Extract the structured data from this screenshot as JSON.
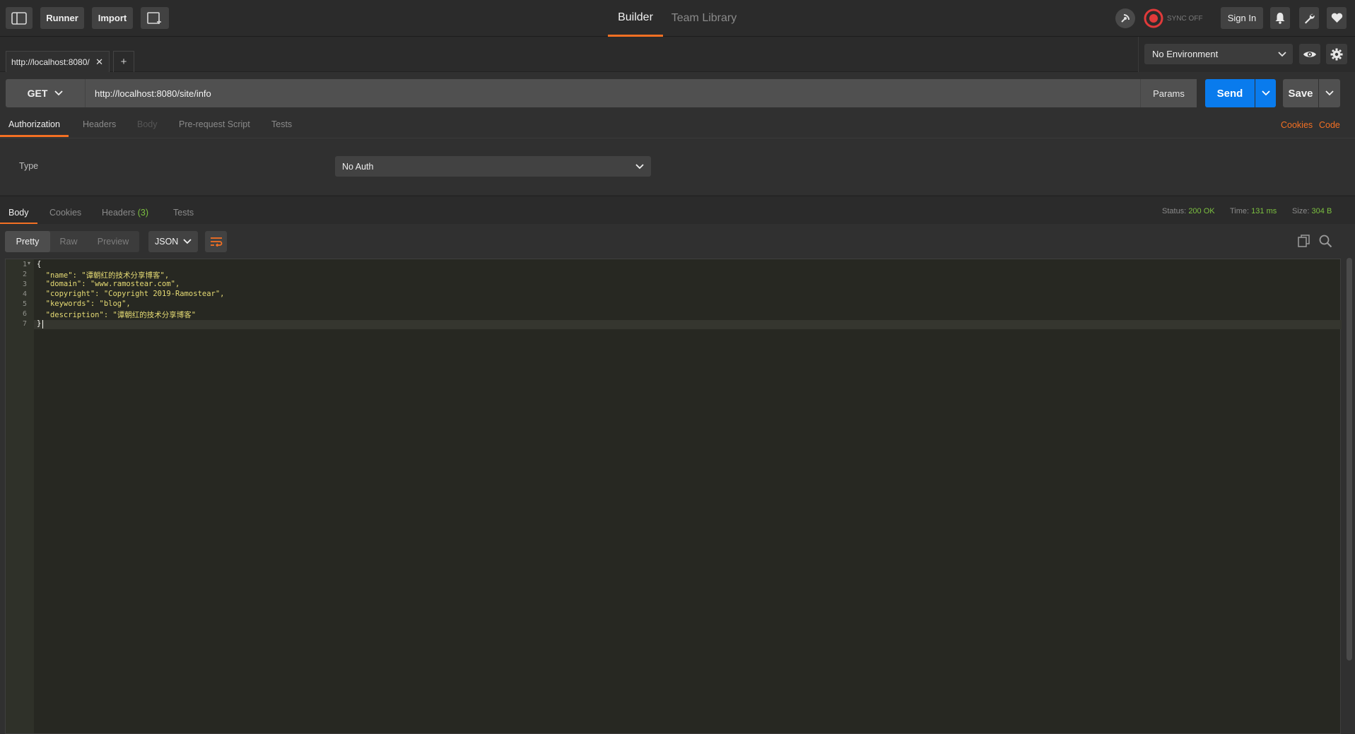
{
  "topbar": {
    "runner_label": "Runner",
    "import_label": "Import",
    "center_tabs": [
      "Builder",
      "Team Library"
    ],
    "sync_label": "SYNC OFF",
    "signin_label": "Sign In"
  },
  "tabs": {
    "active_tab_label": "http://localhost:8080/",
    "close_label": "✕",
    "add_label": "+"
  },
  "environment": {
    "selected": "No Environment"
  },
  "request": {
    "method": "GET",
    "url": "http://localhost:8080/site/info",
    "params_label": "Params",
    "send_label": "Send",
    "save_label": "Save"
  },
  "request_tabs": [
    "Authorization",
    "Headers",
    "Body",
    "Pre-request Script",
    "Tests"
  ],
  "request_links": [
    "Cookies",
    "Code"
  ],
  "auth": {
    "type_label": "Type",
    "selected": "No Auth"
  },
  "response_tabs": {
    "body": "Body",
    "cookies": "Cookies",
    "headers": "Headers",
    "headers_count": "(3)",
    "tests": "Tests"
  },
  "response_stats": {
    "status_label": "Status:",
    "status_value": "200 OK",
    "time_label": "Time:",
    "time_value": "131 ms",
    "size_label": "Size:",
    "size_value": "304 B"
  },
  "format": {
    "modes": [
      "Pretty",
      "Raw",
      "Preview"
    ],
    "language": "JSON"
  },
  "editor": {
    "line_numbers": [
      "1",
      "2",
      "3",
      "4",
      "5",
      "6",
      "7"
    ],
    "lines": [
      "{",
      "  \"name\": \"谭朝红的技术分享博客\",",
      "  \"domain\": \"www.ramostear.com\",",
      "  \"copyright\": \"Copyright 2019-Ramostear\",",
      "  \"keywords\": \"blog\",",
      "  \"description\": \"谭朝红的技术分享博客\"",
      "}"
    ]
  },
  "colors": {
    "accent": "#f47023",
    "send_blue": "#097bed",
    "status_green": "#7cc040"
  }
}
